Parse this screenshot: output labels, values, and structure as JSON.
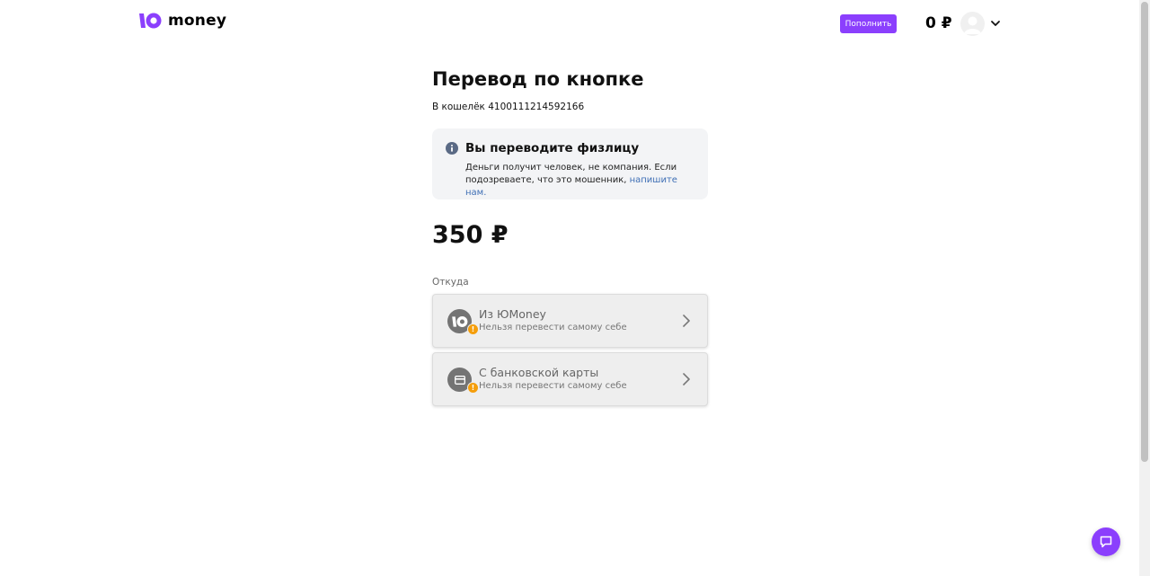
{
  "header": {
    "logo_text": "money",
    "topup_label": "Пополнить",
    "balance": "0 ₽"
  },
  "main": {
    "title": "Перевод по кнопке",
    "wallet_prefix": "В кошелёк ",
    "wallet_number": "4100111214592166",
    "info": {
      "title": "Вы переводите физлицу",
      "text": "Деньги получит человек, не компания. Если подозреваете, что это мошенник, ",
      "link": "напишите нам."
    },
    "amount": "350 ₽",
    "from_label": "Откуда",
    "options": [
      {
        "title": "Из ЮMoney",
        "subtitle": "Нельзя перевести самому себе",
        "icon": "yoomoney-icon"
      },
      {
        "title": "С банковской карты",
        "subtitle": "Нельзя перевести самому себе",
        "icon": "bank-card-icon"
      }
    ]
  },
  "colors": {
    "brand": "#8b3ffd",
    "warning": "#f59e0b",
    "link": "#3f6fb5"
  }
}
